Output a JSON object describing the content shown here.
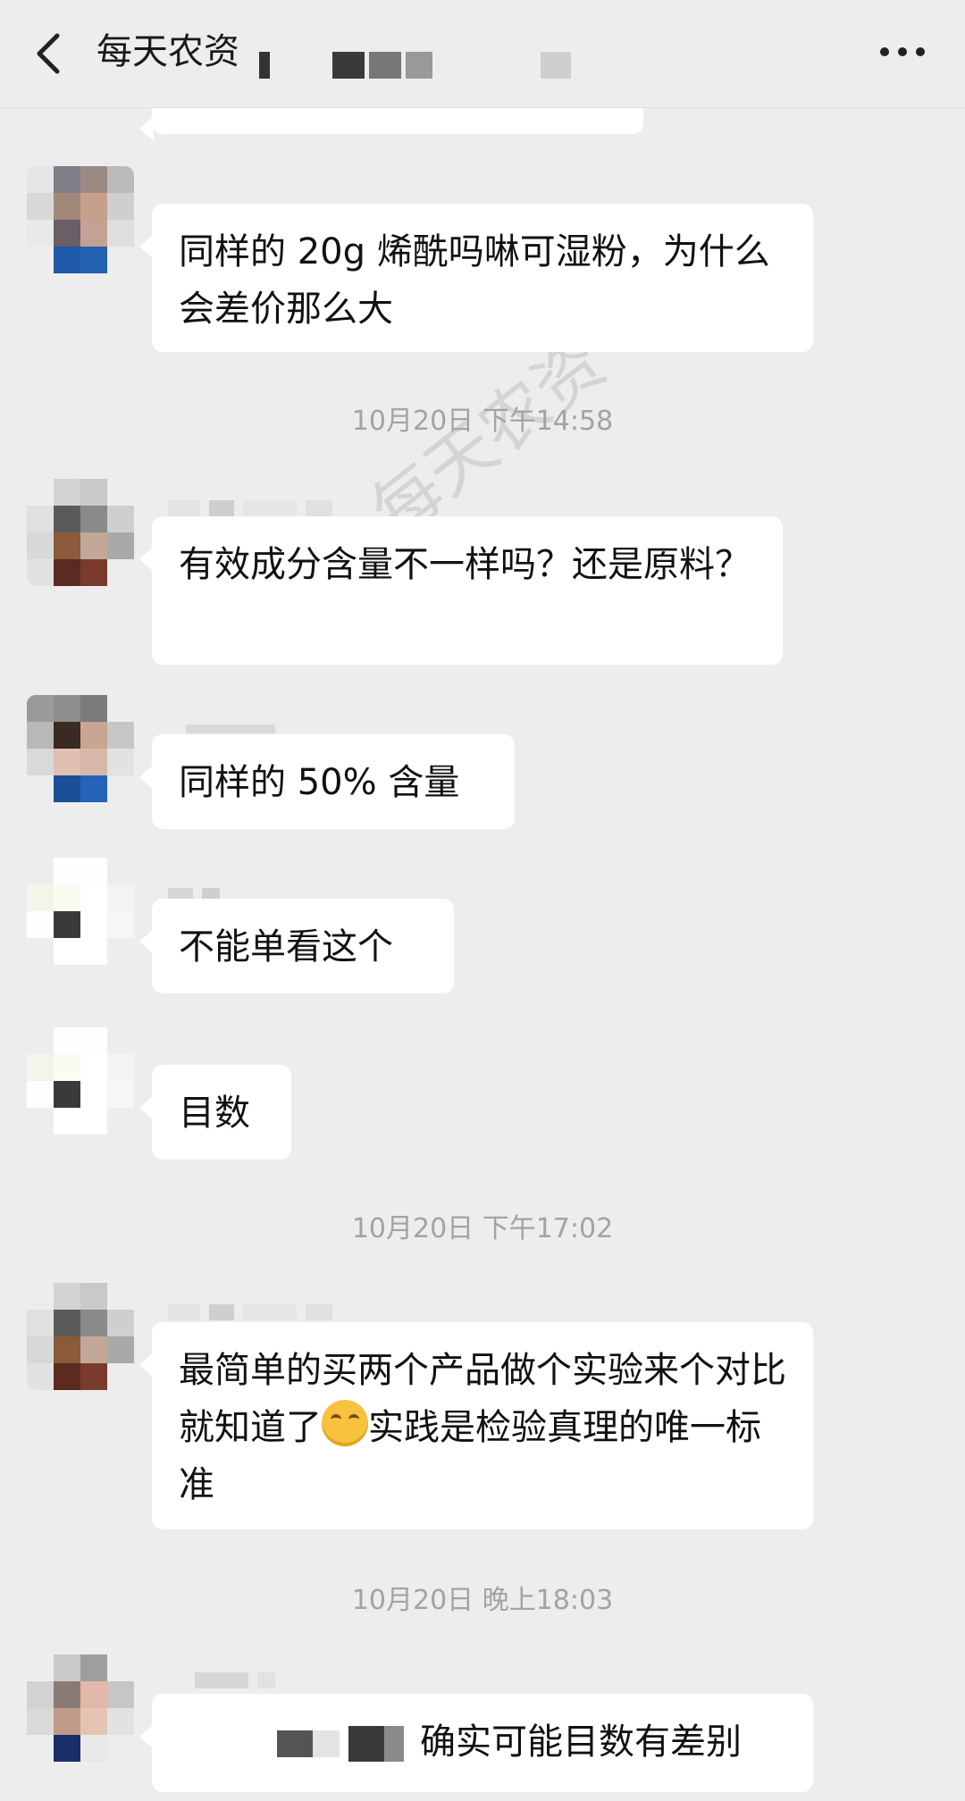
{
  "header": {
    "back_icon": "chevron-left-icon",
    "title": "每天农资",
    "more_icon": "more-horizontal-icon"
  },
  "watermark": "每天农资",
  "timestamps": [
    "10月20日 下午14:58",
    "10月20日 下午17:02",
    "10月20日 晚上18:03"
  ],
  "messages": [
    {
      "text": "同样的 20g 烯酰吗啉可湿粉，为什么会差价那么大"
    },
    {
      "text": "有效成分含量不一样吗？还是原料？"
    },
    {
      "text": "同样的 50% 含量"
    },
    {
      "text": "不能单看这个"
    },
    {
      "text": "目数"
    },
    {
      "text_before": "最简单的买两个产品做个实验来个对比就知道了",
      "emoji": "smirk-emoji",
      "text_after": "实践是检验真理的唯一标准"
    },
    {
      "text": "确实可能目数有差别"
    }
  ],
  "colors": {
    "background": "#ededed",
    "bubble": "#ffffff",
    "timestamp": "#a3a3a3"
  }
}
